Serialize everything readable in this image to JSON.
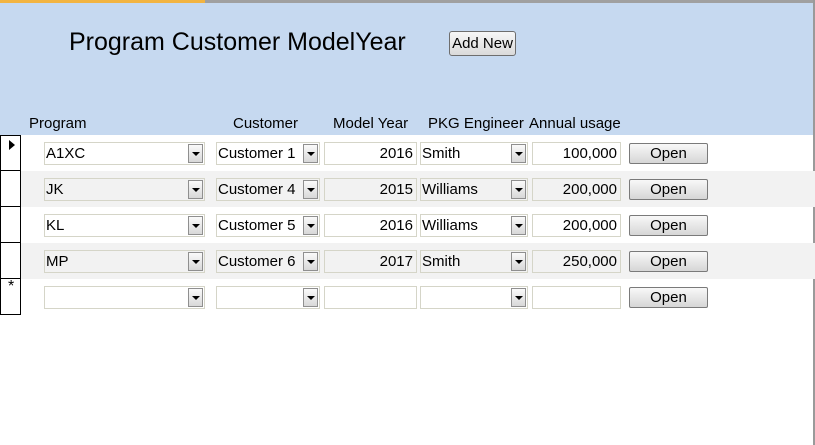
{
  "form": {
    "title": "Program Customer ModelYear",
    "add_new_label": "Add New"
  },
  "columns": {
    "program": "Program",
    "customer": "Customer",
    "model_year": "Model Year",
    "pkg_engineer": "PKG Engineer",
    "annual_usage": "Annual usage"
  },
  "rows": [
    {
      "program": "A1XC",
      "customer": "Customer 1",
      "model_year": "2016",
      "pkg_engineer": "Smith",
      "annual_usage": "100,000",
      "open_label": "Open"
    },
    {
      "program": "JK",
      "customer": "Customer 4",
      "model_year": "2015",
      "pkg_engineer": "Williams",
      "annual_usage": "200,000",
      "open_label": "Open"
    },
    {
      "program": "KL",
      "customer": "Customer 5",
      "model_year": "2016",
      "pkg_engineer": "Williams",
      "annual_usage": "200,000",
      "open_label": "Open"
    },
    {
      "program": "MP",
      "customer": "Customer 6",
      "model_year": "2017",
      "pkg_engineer": "Smith",
      "annual_usage": "250,000",
      "open_label": "Open"
    },
    {
      "program": "",
      "customer": "",
      "model_year": "",
      "pkg_engineer": "",
      "annual_usage": "",
      "open_label": "Open"
    }
  ],
  "record_selectors": [
    "current-record-arrow",
    "",
    "",
    "",
    "new-record-star"
  ],
  "new_record_marker": "*",
  "colors": {
    "header_bg": "#c6d9f0",
    "alt_row_bg": "#f2f2f2",
    "tab_accent": "#f2b441"
  }
}
